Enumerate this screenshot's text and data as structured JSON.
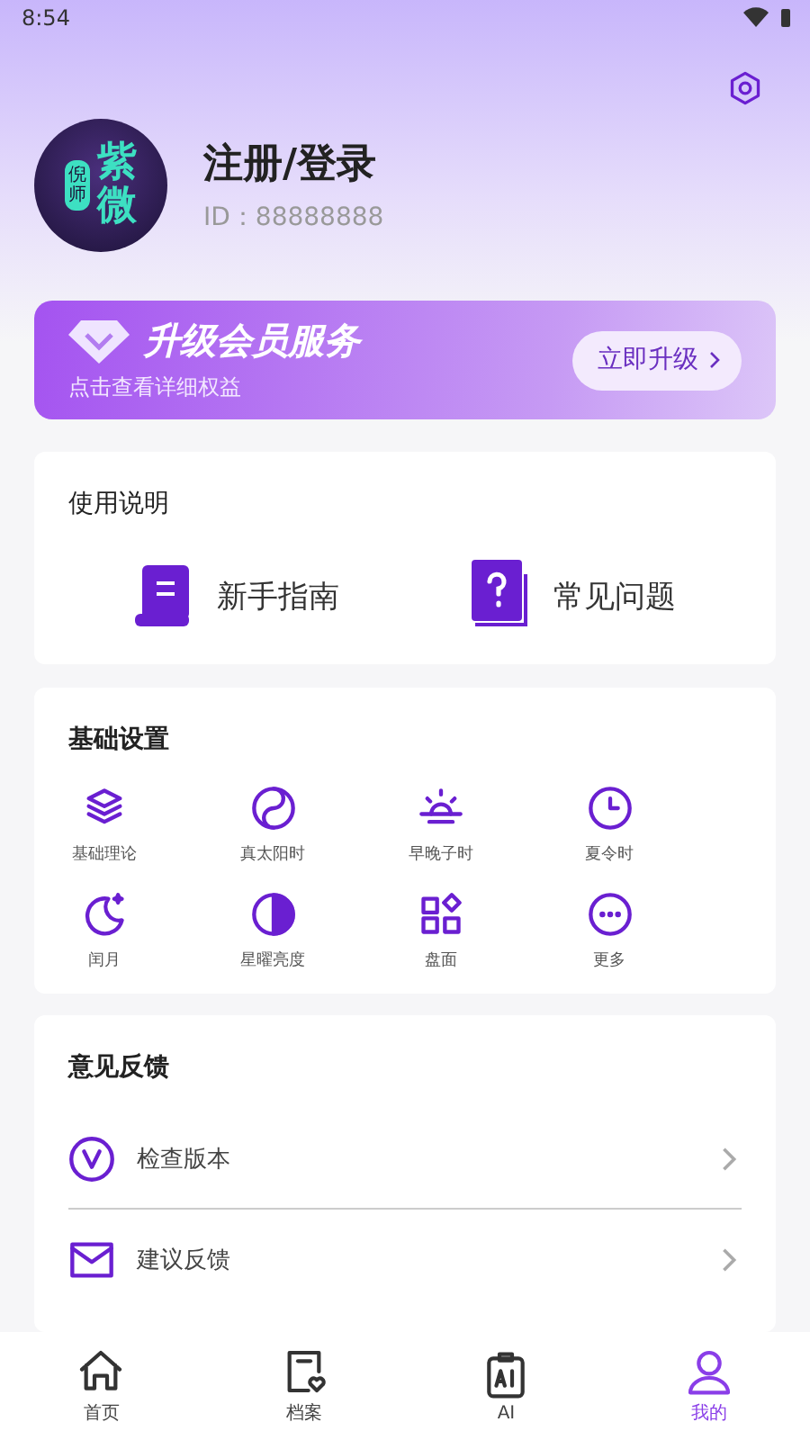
{
  "status_bar": {
    "time": "8:54"
  },
  "profile": {
    "avatar_small": "倪师",
    "avatar_big": "紫微",
    "name": "注册/登录",
    "id": "ID：88888888"
  },
  "vip_banner": {
    "title": "升级会员服务",
    "subtitle": "点击查看详细权益",
    "button": "立即升级"
  },
  "guide": {
    "title": "使用说明",
    "items": [
      {
        "kind": "scroll",
        "label": "新手指南"
      },
      {
        "kind": "question",
        "label": "常见问题"
      }
    ]
  },
  "settings": {
    "title": "基础设置",
    "items": [
      {
        "kind": "layers",
        "label": "基础理论"
      },
      {
        "kind": "yinyang",
        "label": "真太阳时"
      },
      {
        "kind": "sunrise",
        "label": "早晚子时"
      },
      {
        "kind": "clock",
        "label": "夏令时"
      },
      {
        "kind": "moon",
        "label": "闰月"
      },
      {
        "kind": "contrast",
        "label": "星曜亮度"
      },
      {
        "kind": "grid",
        "label": "盘面"
      },
      {
        "kind": "more",
        "label": "更多"
      }
    ]
  },
  "feedback": {
    "title": "意见反馈",
    "items": [
      {
        "kind": "version",
        "label": "检查版本"
      },
      {
        "kind": "mail",
        "label": "建议反馈"
      }
    ]
  },
  "tab_bar": [
    {
      "kind": "home",
      "label": "首页",
      "selected": false
    },
    {
      "kind": "file",
      "label": "档案",
      "selected": false
    },
    {
      "kind": "ai",
      "label": "AI",
      "selected": false
    },
    {
      "kind": "user",
      "label": "我的",
      "selected": true
    }
  ]
}
